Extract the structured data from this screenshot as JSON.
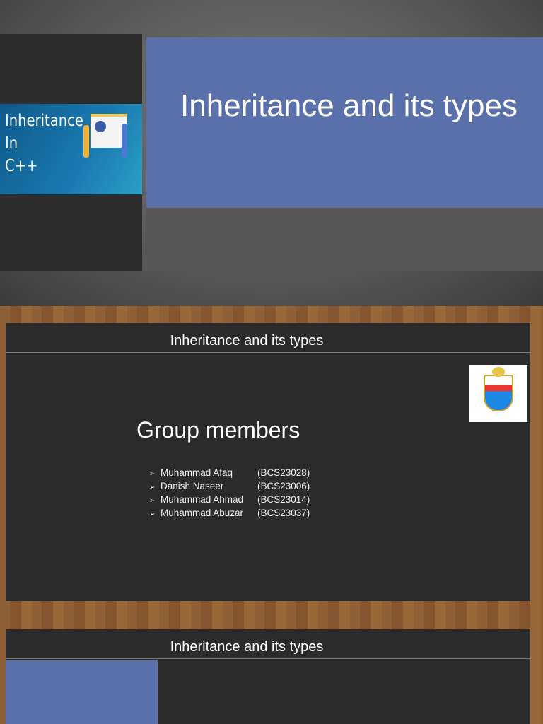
{
  "slide1": {
    "thumbnail_text": [
      "Inheritance",
      "In",
      "C++"
    ],
    "title": "Inheritance and its types"
  },
  "slide2": {
    "header": "Inheritance and its types",
    "heading": "Group members",
    "logo": "University of the Punjab",
    "members": [
      {
        "name": "Muhammad Afaq",
        "id": "(BCS23028)"
      },
      {
        "name": "Danish Naseer",
        "id": "(BCS23006)"
      },
      {
        "name": "Muhammad Ahmad",
        "id": "(BCS23014)"
      },
      {
        "name": "Muhammad Abuzar",
        "id": "(BCS23037)"
      }
    ],
    "bullet": "➢"
  },
  "slide3": {
    "header": "Inheritance and its types"
  }
}
